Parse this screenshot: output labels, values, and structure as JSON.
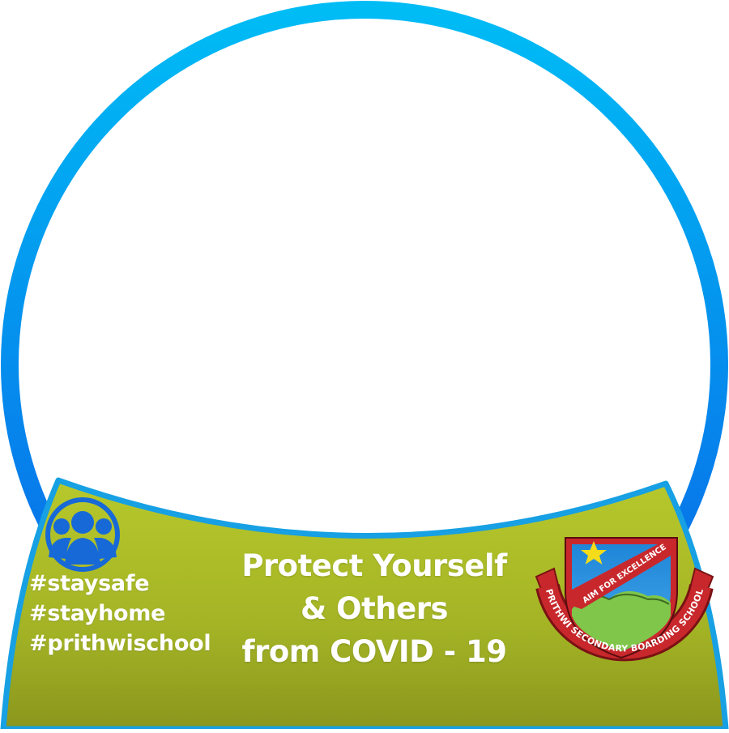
{
  "frame": {
    "ring_colors": [
      "#00bbf5",
      "#0b62e6"
    ],
    "banner_colors": [
      "#b4c52b",
      "#8c991f"
    ],
    "banner_border": "#17a0e3"
  },
  "hashtags": [
    "#staysafe",
    "#stayhome",
    "#prithwischool"
  ],
  "headline": [
    "Protect Yourself",
    "& Others",
    "from COVID - 19"
  ],
  "community_icon": "people-group-icon",
  "school_logo": {
    "motto": "AIM FOR EXCELLENCE",
    "ribbon_text": "PRITHWI SECONDARY BOARDING SCHOOL"
  }
}
